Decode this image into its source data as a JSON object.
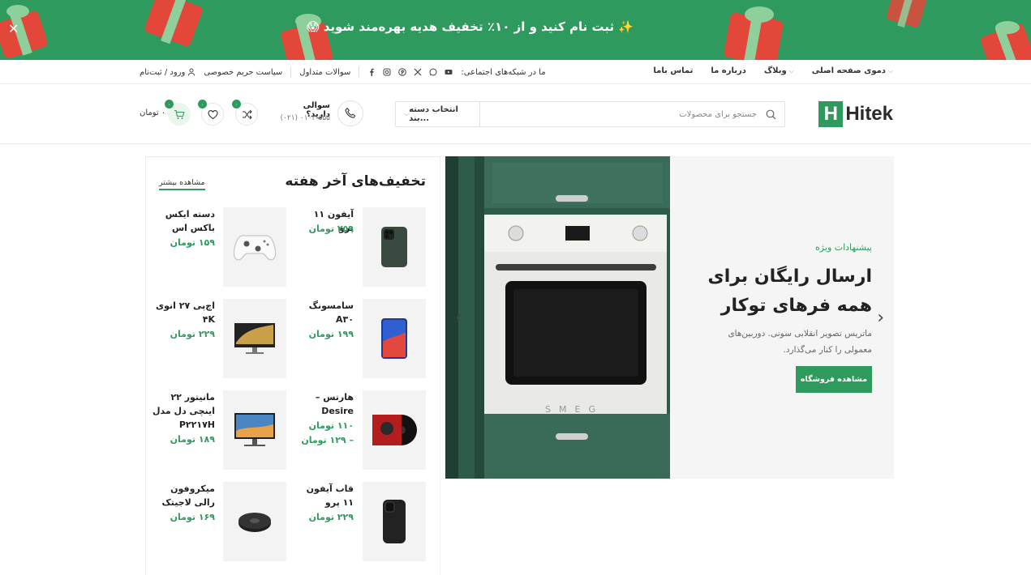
{
  "promo": {
    "text": "✨ ثبت نام کنید و از ۱۰٪ تخفیف هدیه بهره‌مند شوید 😱",
    "close_icon": "close-icon"
  },
  "topnav": {
    "items": [
      {
        "label": "دموی صفحه اصلی",
        "has_caret": true
      },
      {
        "label": "وبلاگ",
        "has_caret": true
      },
      {
        "label": "درباره ما",
        "has_caret": false
      },
      {
        "label": "تماس باما",
        "has_caret": false
      }
    ],
    "social_label": "ما در شبکه‌های اجتماعی:",
    "social_icons": [
      "facebook-icon",
      "instagram-icon",
      "pinterest-icon",
      "x-icon",
      "whatsapp-icon",
      "youtube-icon"
    ],
    "faq": "سوالات متداول",
    "privacy": "سیاست حریم خصوصی",
    "login": "ورود / ثبت‌نام"
  },
  "header": {
    "logo_letter": "H",
    "logo_text": "Hitek",
    "search_placeholder": "جستجو برای محصولات",
    "category_select": "انتخاب دسته بند...",
    "phone_question": "سوالی دارید؟",
    "phone_number": "(۰۲۱) ۰۱۰۳-۵۵۵",
    "compare_count": "۰",
    "wishlist_count": "۰",
    "cart_count": "۰",
    "cart_total": "۰ تومان"
  },
  "hero": {
    "subtitle": "پیشنهادات ویژه",
    "title": "ارسال رایگان برای همه فرهای توکار",
    "description": "ماتریس تصویر انقلابی سونی. دوربین‌های معمولی را کنار می‌گذارد.",
    "button": "مشاهده فروشگاه",
    "oven_brand": "SMEG",
    "accent": "#2e9a5d"
  },
  "deals": {
    "title": "تخفیف‌های آخر هفته",
    "more": "مشاهده بیشتر",
    "products": [
      {
        "name": "آیفون ۱۱ پرو",
        "prices": [
          "۲۵۹ تومان"
        ],
        "icon": "iphone-icon"
      },
      {
        "name": "دسته ایکس باکس اس",
        "prices": [
          "۱۵۹ تومان"
        ],
        "icon": "xbox-controller-icon"
      },
      {
        "name": "سامسونگ A۳۰",
        "prices": [
          "۱۹۹ تومان"
        ],
        "icon": "samsung-phone-icon"
      },
      {
        "name": "اچ‌پی ۲۷ انوی ۴K",
        "prices": [
          "۲۲۹ تومان"
        ],
        "icon": "hp-monitor-icon"
      },
      {
        "name": "هارتس – Desire",
        "prices": [
          "۱۱۰ تومان",
          "– ۱۲۹ تومان"
        ],
        "icon": "vinyl-record-icon"
      },
      {
        "name": "مانیتور ۲۲ اینچی دل مدل P۲۲۱۷H",
        "prices": [
          "۱۸۹ تومان"
        ],
        "icon": "dell-monitor-icon"
      },
      {
        "name": "قاب آیفون ۱۱ پرو",
        "prices": [
          "۲۲۹ تومان"
        ],
        "icon": "phone-case-icon"
      },
      {
        "name": "میکروفون رالی لاجیتک",
        "prices": [
          "۱۶۹ تومان"
        ],
        "icon": "speakerphone-icon"
      }
    ]
  }
}
